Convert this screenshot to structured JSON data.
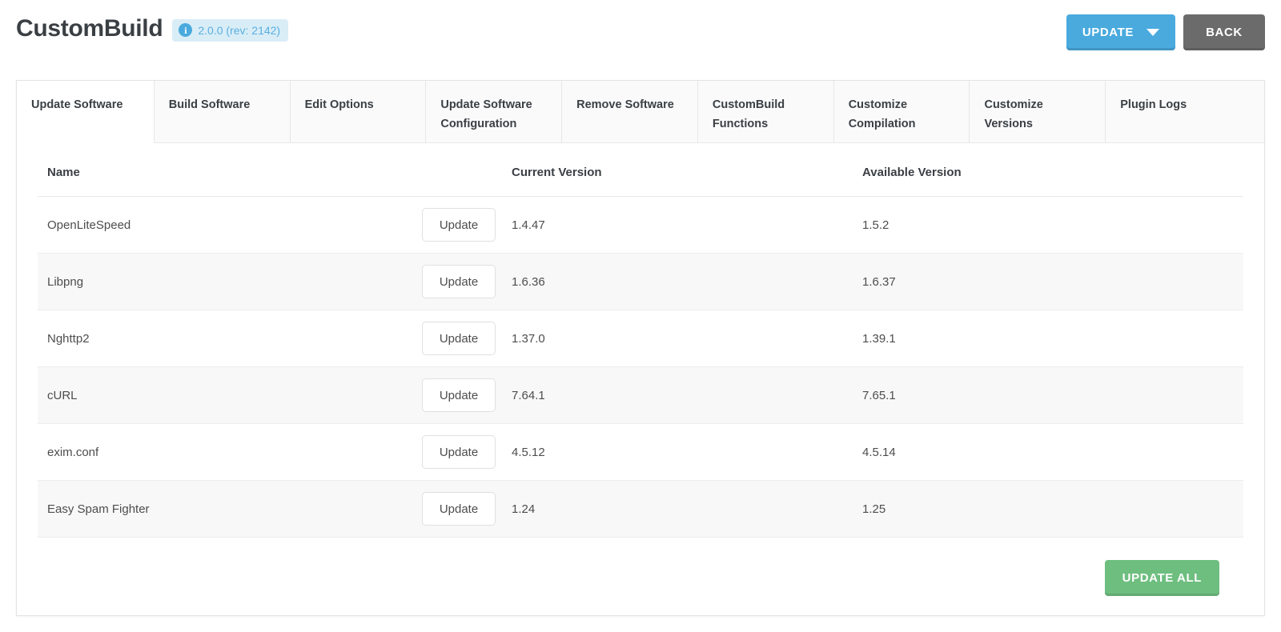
{
  "header": {
    "title": "CustomBuild",
    "version_badge": {
      "icon": "info-icon",
      "icon_glyph": "i",
      "text": "2.0.0 (rev: 2142)"
    },
    "update_button": "UPDATE",
    "back_button": "BACK"
  },
  "tabs": [
    {
      "label": "Update Software",
      "active": true
    },
    {
      "label": "Build Software",
      "active": false
    },
    {
      "label": "Edit Options",
      "active": false
    },
    {
      "label": "Update Software Configuration",
      "active": false
    },
    {
      "label": "Remove Software",
      "active": false
    },
    {
      "label": "CustomBuild Functions",
      "active": false
    },
    {
      "label": "Customize Compilation",
      "active": false
    },
    {
      "label": "Customize Versions",
      "active": false
    },
    {
      "label": "Plugin Logs",
      "active": false
    }
  ],
  "table": {
    "columns": [
      "Name",
      "",
      "Current Version",
      "Available Version"
    ],
    "row_action_label": "Update",
    "rows": [
      {
        "name": "OpenLiteSpeed",
        "action": "Update",
        "current": "1.4.47",
        "available": "1.5.2"
      },
      {
        "name": "Libpng",
        "action": "Update",
        "current": "1.6.36",
        "available": "1.6.37"
      },
      {
        "name": "Nghttp2",
        "action": "Update",
        "current": "1.37.0",
        "available": "1.39.1"
      },
      {
        "name": "cURL",
        "action": "Update",
        "current": "7.64.1",
        "available": "7.65.1"
      },
      {
        "name": "exim.conf",
        "action": "Update",
        "current": "4.5.12",
        "available": "4.5.14"
      },
      {
        "name": "Easy Spam Fighter",
        "action": "Update",
        "current": "1.24",
        "available": "1.25"
      }
    ]
  },
  "footer": {
    "update_all_button": "UPDATE ALL"
  },
  "colors": {
    "accent_blue": "#4aaade",
    "badge_bg": "#d9edf7",
    "back_gray": "#6b6b6b",
    "success_green": "#6ebe7f",
    "text_dark": "#3a3f44",
    "row_stripe": "#f8f8f8"
  }
}
